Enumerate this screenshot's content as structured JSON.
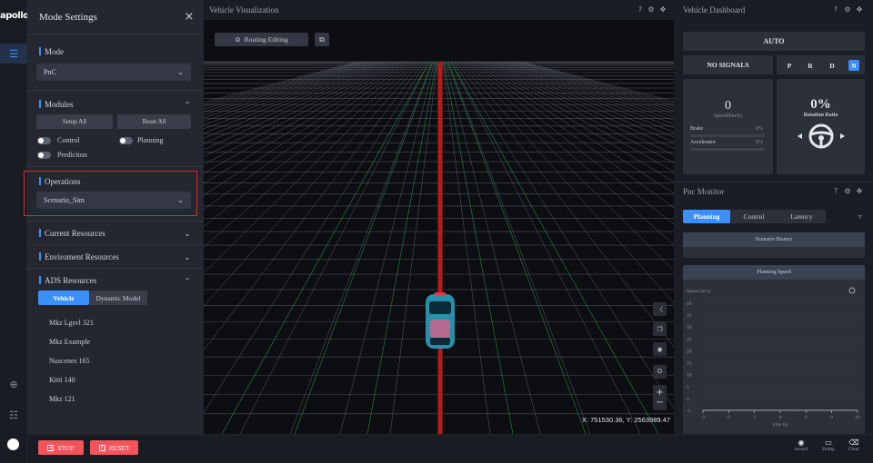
{
  "rail": {
    "logo": "apollo",
    "active_icon": "layers-icon"
  },
  "settings": {
    "title": "Mode Settings",
    "close": "×",
    "mode": {
      "label": "Mode",
      "value": "PnC"
    },
    "modules": {
      "label": "Modules",
      "setup_all": "Setup All",
      "reset_all": "Reset All",
      "items": [
        {
          "label": "Control",
          "on": false
        },
        {
          "label": "Planning",
          "on": false
        },
        {
          "label": "Prediction",
          "on": false
        }
      ]
    },
    "operations": {
      "label": "Operations",
      "value": "Scenario_Sim"
    },
    "current_resources": "Current Resources",
    "environment_resources": "Enviroment Resources",
    "ads_resources": {
      "label": "ADS Resources",
      "tabs": [
        "Vehicle",
        "Dynamic Model"
      ],
      "active_tab": "Vehicle",
      "vehicles": [
        "Mkz Lgsvl 321",
        "Mkz Example",
        "Nuscenes 165",
        "Kitti 140",
        "Mkz 121"
      ]
    }
  },
  "viz": {
    "title": "Vehicle Visualization",
    "routing_button": "Routing Editing",
    "coordinates": "X: 751530.36, Y: 2563989.47"
  },
  "dashboard": {
    "title": "Vehicle Dashboard",
    "mode": "AUTO",
    "signals": "NO SIGNALS",
    "gears": [
      "P",
      "R",
      "D",
      "N"
    ],
    "active_gear": "N",
    "speed": {
      "value": "0",
      "unit": "Speed(km/h)"
    },
    "brake": {
      "label": "Brake",
      "value": "0%"
    },
    "accelerator": {
      "label": "Accelerator",
      "value": "0%"
    },
    "rotation": {
      "value": "0%",
      "label": "Rotation Ratio"
    }
  },
  "pnc": {
    "title": "Pnc Monitor",
    "tabs": [
      "Planning",
      "Control",
      "Latency"
    ],
    "active_tab": "Planning",
    "scenario_history": "Scenario History",
    "chart_title": "Planning Speed"
  },
  "chart_data": {
    "type": "line",
    "title": "Planning Speed",
    "ylabel": "Speed (m/s)",
    "xlabel": "time (s)",
    "xlim": [
      -2,
      10
    ],
    "ylim": [
      -5,
      40
    ],
    "x_ticks": [
      "-2",
      "0",
      "2",
      "4",
      "6",
      "8",
      "10"
    ],
    "y_ticks": [
      "40",
      "35",
      "30",
      "25",
      "20",
      "15",
      "10",
      "5",
      "0",
      "-5"
    ],
    "series": []
  },
  "bottom": {
    "stop": "STOP",
    "reset": "RESET",
    "actions": [
      "record",
      "Dump",
      "Clear"
    ]
  },
  "colors": {
    "accent": "#3b8ff6",
    "danger": "#f2545b",
    "highlight_frame": "#d62b2b"
  }
}
